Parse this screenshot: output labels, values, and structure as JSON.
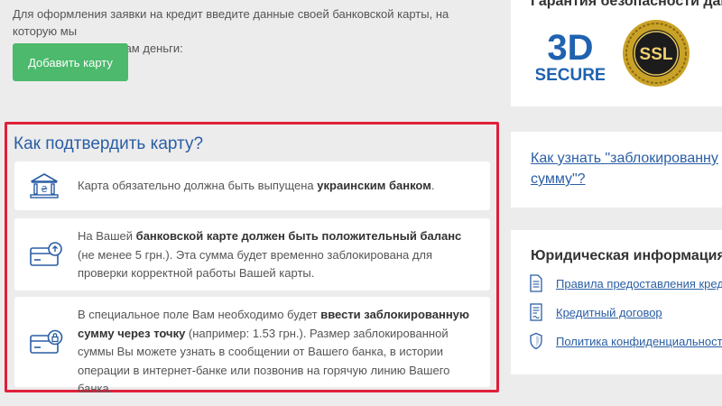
{
  "intro": {
    "line1": "Для оформления заявки на кредит введите данные своей банковской карты, на которую мы",
    "line2": "сможем отправить Вам деньги:"
  },
  "add_card_button": "Добавить карту",
  "confirm": {
    "title": "Как подтвердить карту?",
    "step1": {
      "icon": "bank-hryvnia-icon",
      "pre": "Карта обязательно должна быть выпущена ",
      "bold": "украинским банком",
      "post": "."
    },
    "step2": {
      "icon": "card-coin-icon",
      "pre": "На Вашей ",
      "bold": "банковской карте должен быть положительный баланс",
      "post": " (не менее 5 грн.). Эта сумма будет временно заблокирована для проверки корректной работы Вашей карты."
    },
    "step3": {
      "icon": "card-lock-icon",
      "pre": "В специальное поле Вам необходимо будет ",
      "bold": "ввести заблокированную сумму через точку",
      "post": " (например: 1.53 грн.). Размер заблокированной суммы Вы можете узнать в сообщении от Вашего банка, в истории операции в интернет-банке или позвонив на горячую линию Вашего банка."
    }
  },
  "guarantee": {
    "title": "Гарантия безопасности дан",
    "badge_3d_top": "3D",
    "badge_3d_bottom": "SECURE",
    "badge_ssl": "SSL"
  },
  "howto": {
    "link": "Как узнать \"заблокированну сумму\"?"
  },
  "legal": {
    "title": "Юридическая информация",
    "links": [
      {
        "label": "Правила предоставления кредито",
        "icon": "document-icon"
      },
      {
        "label": "Кредитный договор",
        "icon": "contract-icon"
      },
      {
        "label": "Политика конфиденциальности",
        "icon": "shield-icon"
      }
    ]
  },
  "colors": {
    "accent_blue": "#2a5ea4",
    "button_green": "#4cb96c",
    "highlight_red": "#e0203a",
    "gold": "#c9a227"
  }
}
